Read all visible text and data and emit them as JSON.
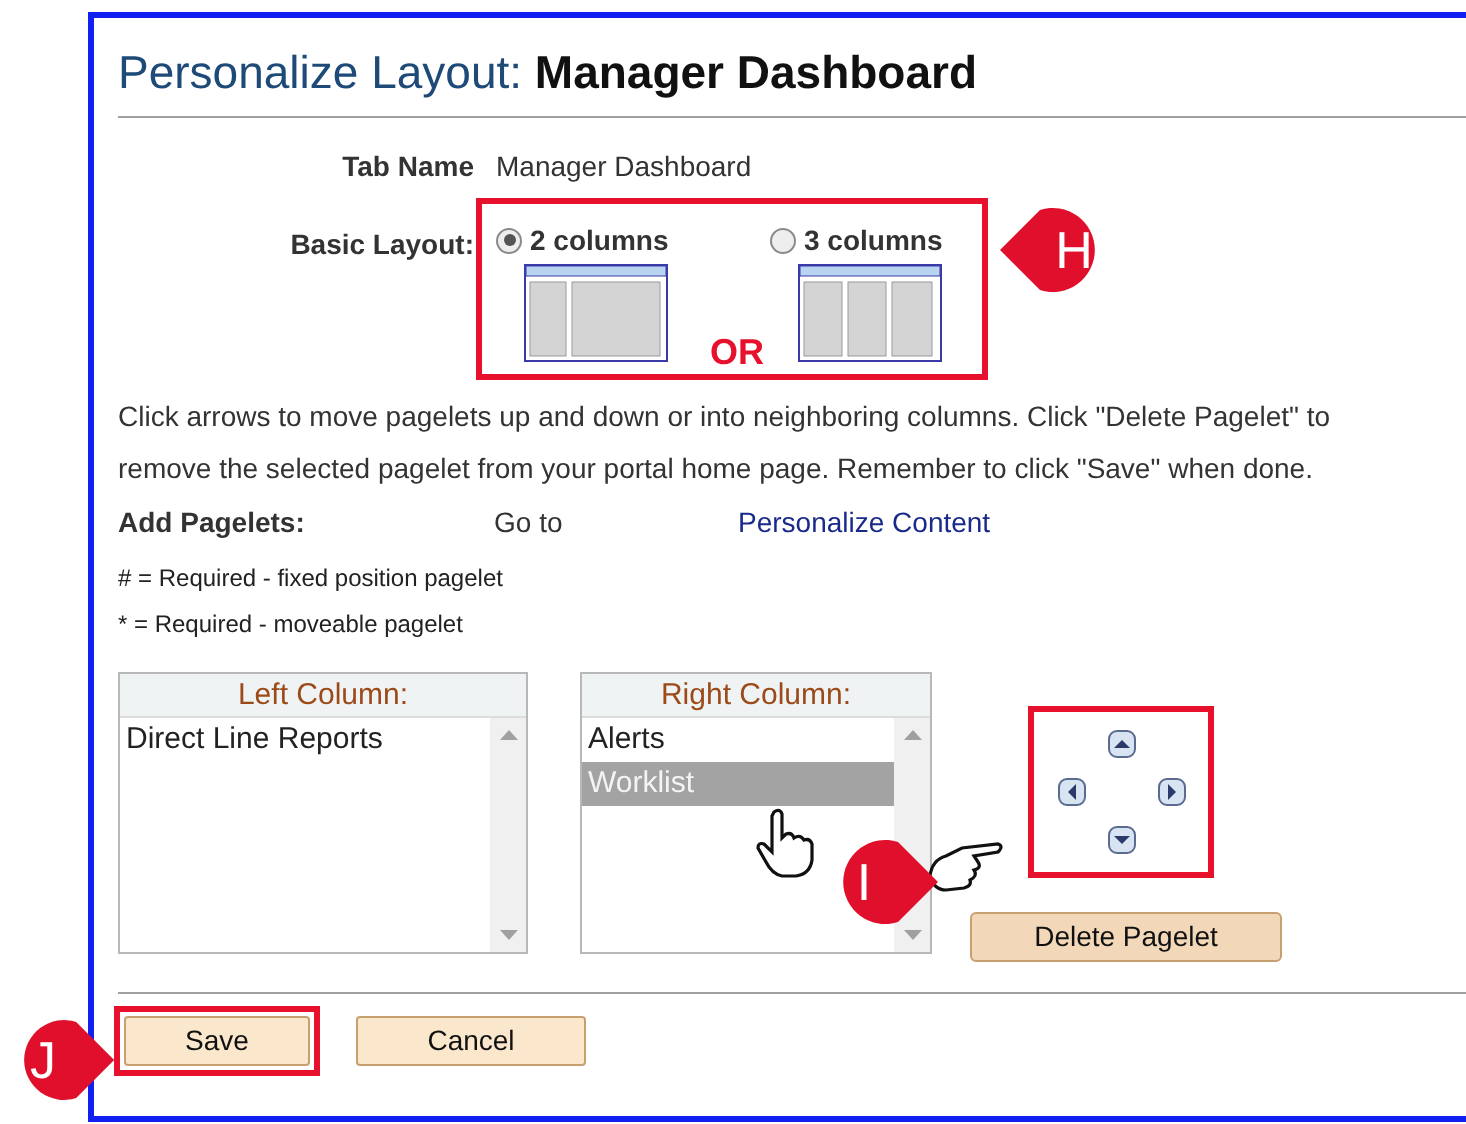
{
  "header": {
    "title_prefix": "Personalize Layout:",
    "title_name": "Manager Dashboard"
  },
  "tab_name": {
    "label": "Tab Name",
    "value": "Manager Dashboard"
  },
  "basic_layout": {
    "label": "Basic Layout:",
    "highlighted": true,
    "separator": "OR",
    "options": [
      {
        "label": "2 columns",
        "kind": "two-column",
        "selected": true
      },
      {
        "label": "3 columns",
        "kind": "three-column",
        "selected": false
      }
    ]
  },
  "instructions": "Click arrows to move pagelets up and down or into neighboring columns. Click \"Delete Pagelet\" to remove the selected pagelet from your portal home page. Remember to click \"Save\" when done.",
  "add_pagelets": {
    "label": "Add Pagelets:",
    "go_to": "Go to",
    "link": "Personalize Content"
  },
  "legend": [
    "# = Required - fixed position pagelet",
    "* = Required - moveable pagelet"
  ],
  "columns": [
    {
      "header": "Left Column:",
      "items": [
        {
          "label": "Direct Line Reports",
          "selected": false
        }
      ]
    },
    {
      "header": "Right Column:",
      "items": [
        {
          "label": "Alerts",
          "selected": false
        },
        {
          "label": "Worklist",
          "selected": true
        }
      ]
    }
  ],
  "move_controls": {
    "highlighted": true
  },
  "delete_button": "Delete Pagelet",
  "buttons": [
    {
      "label": "Save",
      "highlighted": true
    },
    {
      "label": "Cancel",
      "highlighted": false
    }
  ],
  "callouts": [
    {
      "letter": "H"
    },
    {
      "letter": "I"
    },
    {
      "letter": "J"
    }
  ]
}
